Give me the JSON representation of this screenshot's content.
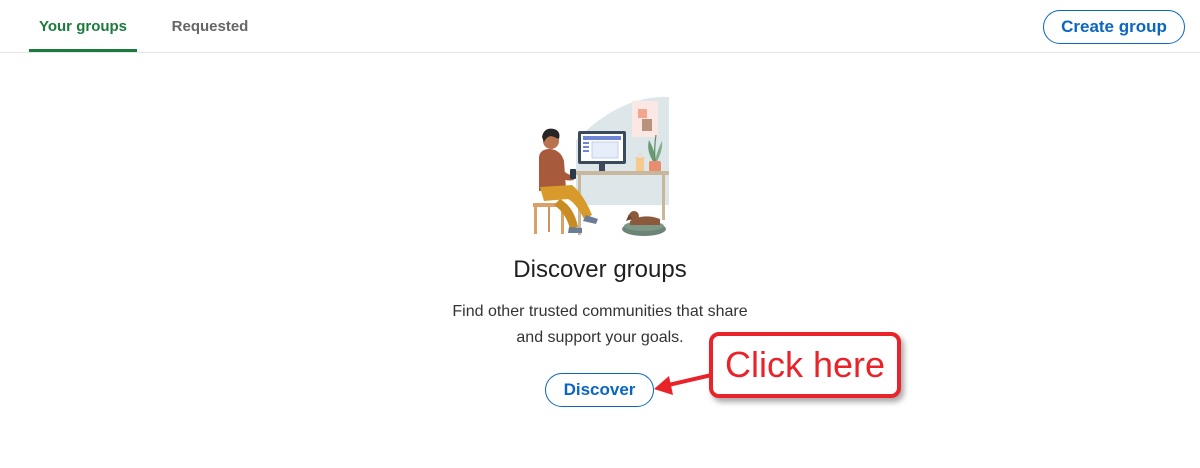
{
  "tabs": {
    "items": [
      {
        "label": "Your groups",
        "active": true
      },
      {
        "label": "Requested",
        "active": false
      }
    ]
  },
  "header": {
    "create_group_label": "Create group"
  },
  "empty_state": {
    "illustration": "person-working-at-desk-illustration",
    "title": "Discover groups",
    "description_line1": "Find other trusted communities that share",
    "description_line2": "and support your goals.",
    "discover_label": "Discover"
  },
  "annotation": {
    "callout_text": "Click here",
    "arrow_icon": "red-arrow-left-icon"
  },
  "colors": {
    "active_tab": "#1d7a3e",
    "link_blue": "#0a66c2",
    "annotation_red": "#e8232a"
  }
}
